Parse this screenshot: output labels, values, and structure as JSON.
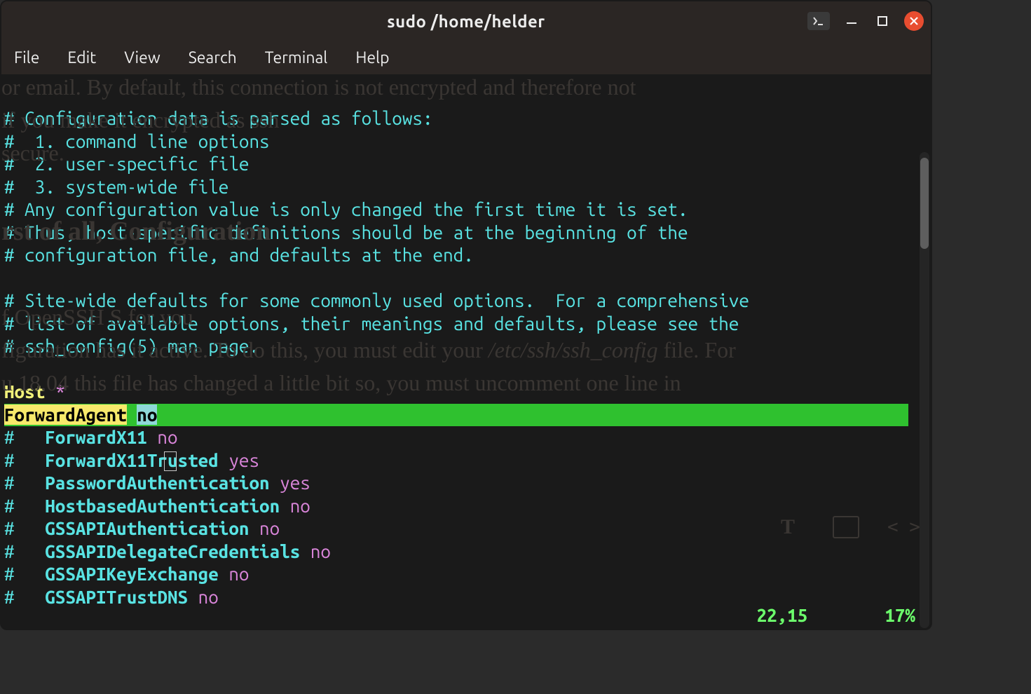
{
  "title": "sudo  /home/helder",
  "menu": [
    "File",
    "Edit",
    "View",
    "Search",
    "Terminal",
    "Help"
  ],
  "lines": [
    {
      "t": "comment",
      "text": "# Configuration data is parsed as follows:"
    },
    {
      "t": "comment",
      "text": "#  1. command line options"
    },
    {
      "t": "comment",
      "text": "#  2. user-specific file"
    },
    {
      "t": "comment",
      "text": "#  3. system-wide file"
    },
    {
      "t": "comment",
      "text": "# Any configuration value is only changed the first time it is set."
    },
    {
      "t": "comment",
      "text": "# Thus, host-specific definitions should be at the beginning of the"
    },
    {
      "t": "comment",
      "text": "# configuration file, and defaults at the end."
    },
    {
      "t": "blank",
      "text": ""
    },
    {
      "t": "comment",
      "text": "# Site-wide defaults for some commonly used options.  For a comprehensive"
    },
    {
      "t": "comment",
      "text": "# list of available options, their meanings and defaults, please see the"
    },
    {
      "t": "comment",
      "text": "# ssh_config(5) man page."
    },
    {
      "t": "blank",
      "text": ""
    },
    {
      "t": "host",
      "kw": "Host",
      "star": "*"
    },
    {
      "t": "hl",
      "key": "ForwardAgent",
      "val": "no"
    },
    {
      "t": "opt",
      "hash": "#",
      "key": "ForwardX11",
      "val": "no"
    },
    {
      "t": "opt",
      "hash": "#",
      "key": "ForwardX11Trusted",
      "val": "yes"
    },
    {
      "t": "opt",
      "hash": "#",
      "key": "PasswordAuthentication",
      "val": "yes"
    },
    {
      "t": "opt",
      "hash": "#",
      "key": "HostbasedAuthentication",
      "val": "no"
    },
    {
      "t": "opt",
      "hash": "#",
      "key": "GSSAPIAuthentication",
      "val": "no"
    },
    {
      "t": "opt",
      "hash": "#",
      "key": "GSSAPIDelegateCredentials",
      "val": "no"
    },
    {
      "t": "opt",
      "hash": "#",
      "key": "GSSAPIKeyExchange",
      "val": "no"
    },
    {
      "t": "opt",
      "hash": "#",
      "key": "GSSAPITrustDNS",
      "val": "no"
    }
  ],
  "status": {
    "pos": "22,15",
    "pct": "17%"
  },
  "ghost": {
    "p1a": " or email. By default, this connection is not encrypted and therefore not",
    "p1b": "              if you              make it encrypted as ssh",
    "p1c": "                                    secure.",
    "h2": "",
    "p2a": "     f   OpenSSH S                     for            you",
    "p2b": "figuration has it active. To do this, you must edit your ",
    "p2b_ital": "/etc/ssh/ssh_config",
    "p2b_end": " file. For",
    "p2c": "    u 18.04 this file has changed a little bit so, you must uncomment one line in"
  }
}
